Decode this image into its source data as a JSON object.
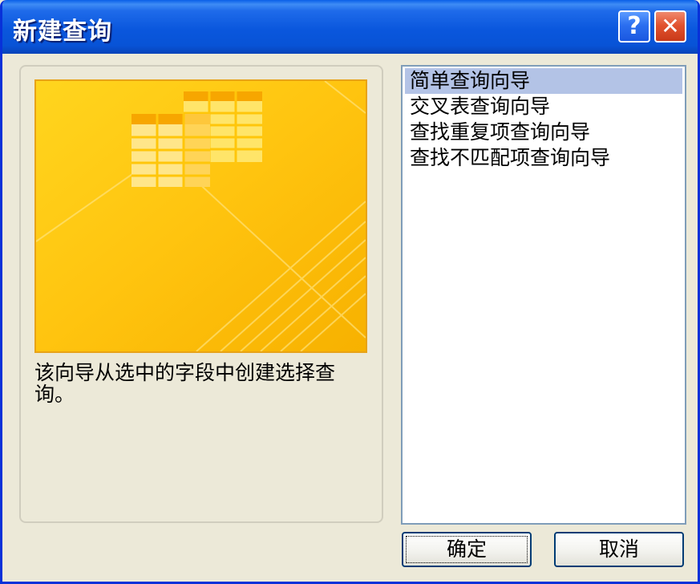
{
  "window": {
    "title": "新建查询",
    "help_label": "?",
    "close_label": "✕"
  },
  "description": "该向导从选中的字段中创建选择查询。",
  "wizard_list": {
    "items": [
      {
        "label": "简单查询向导",
        "selected": true
      },
      {
        "label": "交叉表查询向导",
        "selected": false
      },
      {
        "label": "查找重复项查询向导",
        "selected": false
      },
      {
        "label": "查找不匹配项查询向导",
        "selected": false
      }
    ]
  },
  "buttons": {
    "ok_label": "确定",
    "cancel_label": "取消"
  },
  "colors": {
    "titlebar": "#0A57DD",
    "selection": "#B3C3E6",
    "preview_bg": "#FFC20E"
  }
}
